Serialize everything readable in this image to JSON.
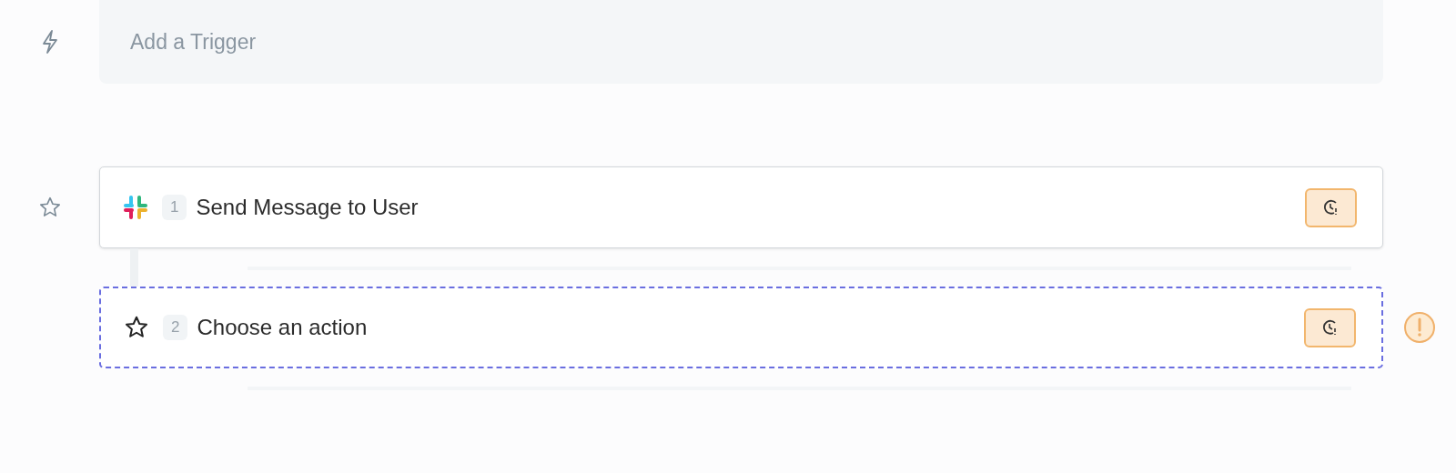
{
  "trigger": {
    "placeholder": "Add a Trigger"
  },
  "steps": [
    {
      "kind": "app",
      "number": "1",
      "title": "Send Message to User",
      "selected": false,
      "warning": false,
      "rail_star": true
    },
    {
      "kind": "empty",
      "number": "2",
      "title": "Choose an action",
      "selected": true,
      "warning": true,
      "rail_star": false
    }
  ]
}
